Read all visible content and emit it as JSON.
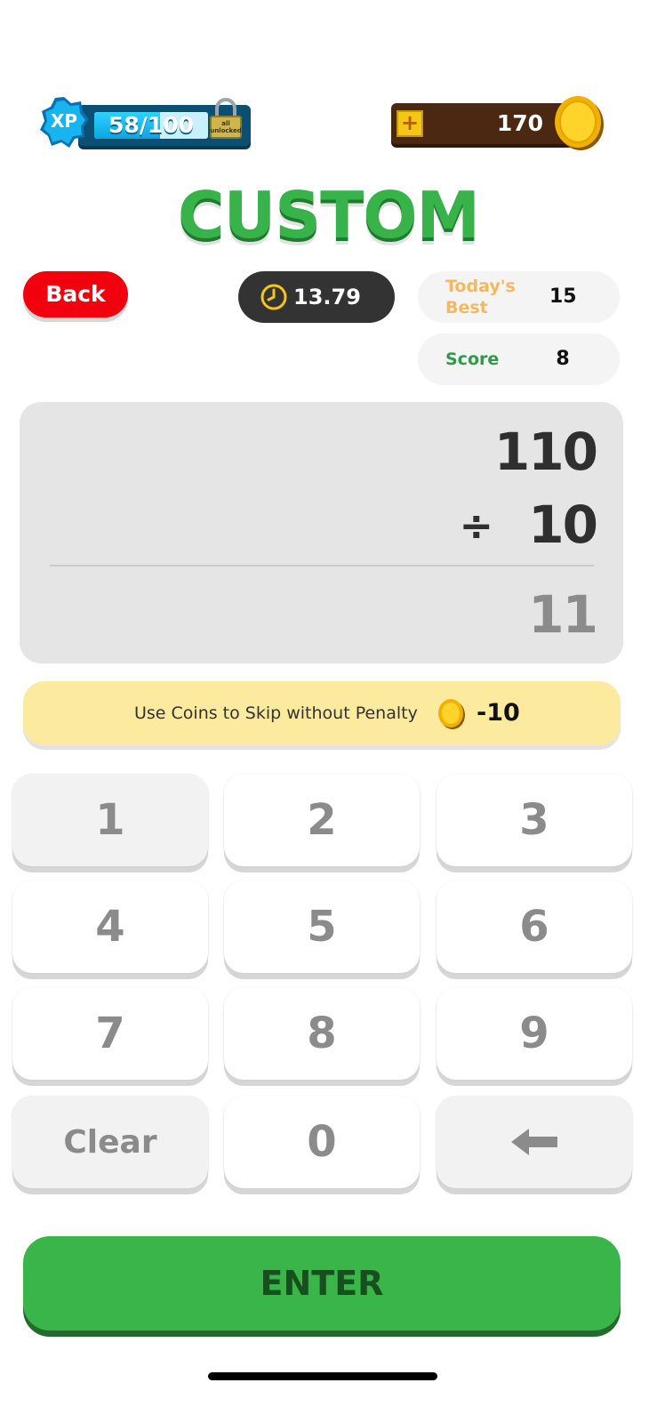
{
  "header": {
    "xp_badge": "XP",
    "xp_text": "58/100",
    "xp_progress": 0.58,
    "lock_text": "all unlocked",
    "coins_plus": "+",
    "coins": "170"
  },
  "title": "CUSTOM",
  "back_label": "Back",
  "timer": "13.79",
  "stats": {
    "best_label": "Today's Best",
    "best_value": "15",
    "score_label": "Score",
    "score_value": "8"
  },
  "problem": {
    "operand1": "110",
    "operator": "÷",
    "operand2": "10",
    "answer": "11"
  },
  "skip": {
    "text": "Use Coins to Skip without Penalty",
    "cost": "-10"
  },
  "keypad": {
    "k1": "1",
    "k2": "2",
    "k3": "3",
    "k4": "4",
    "k5": "5",
    "k6": "6",
    "k7": "7",
    "k8": "8",
    "k9": "9",
    "clear": "Clear",
    "k0": "0",
    "backspace_icon": "left-arrow-icon"
  },
  "enter_label": "ENTER",
  "colors": {
    "green": "#3ab54a",
    "red": "#f2000e",
    "xp_blue": "#0aa6e2",
    "coin_gold": "#f5c518"
  }
}
